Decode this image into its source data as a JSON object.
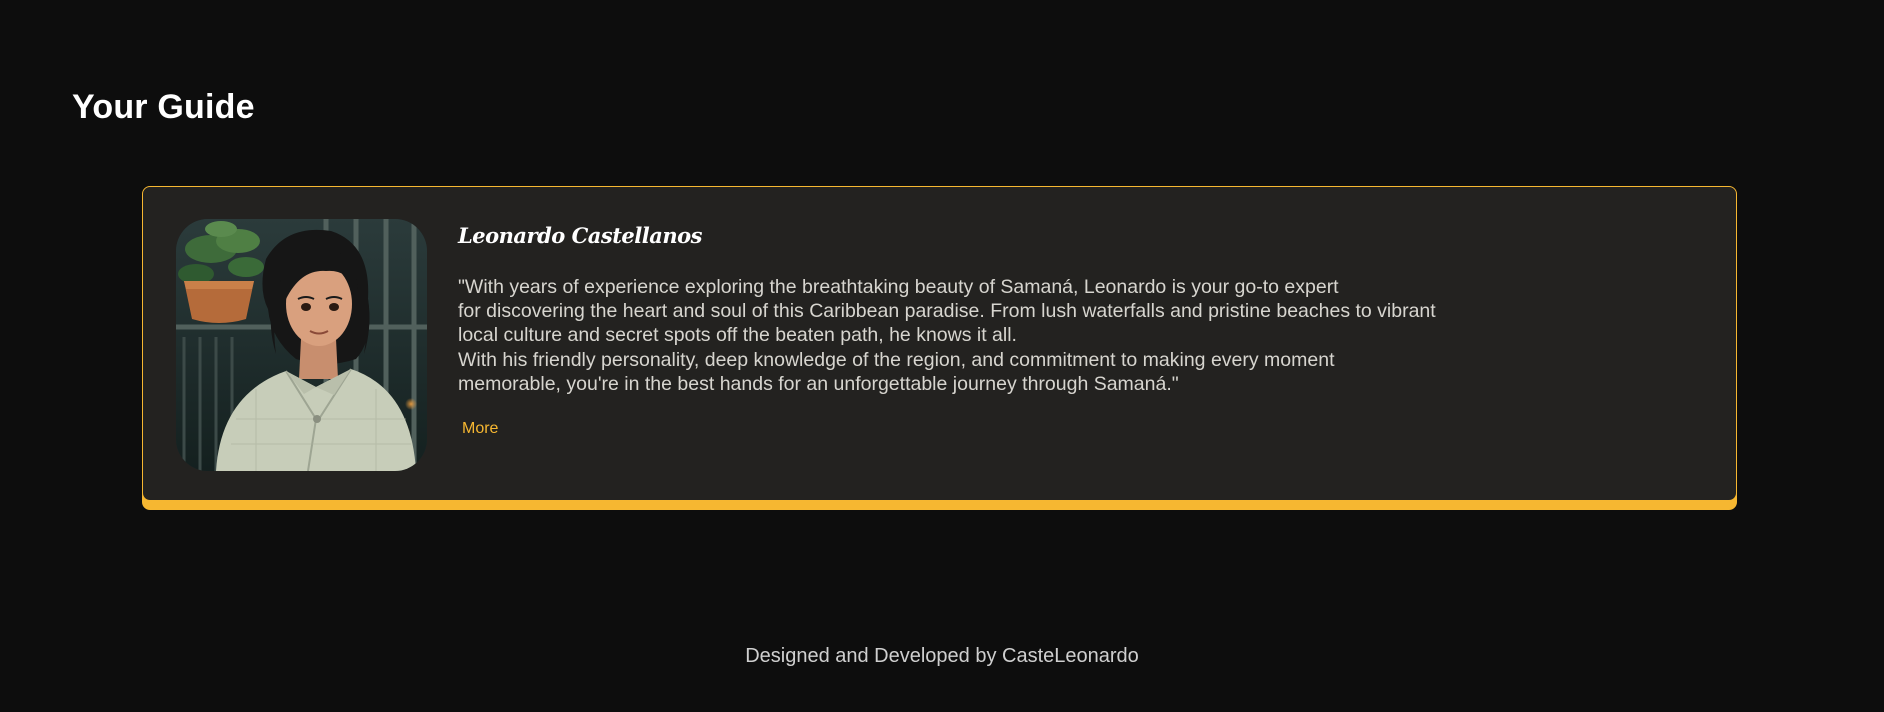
{
  "section": {
    "title": "Your Guide"
  },
  "guide": {
    "name": "Leonardo Castellanos",
    "bio_lines": [
      "\"With years of experience exploring the breathtaking beauty of Samaná, Leonardo is your go-to expert",
      "for discovering the heart and soul of this Caribbean paradise. From lush waterfalls and pristine beaches to vibrant",
      "local culture and secret spots off the beaten path, he knows it all.",
      "With his friendly personality, deep knowledge of the region, and commitment to making every moment",
      "memorable, you're in the best hands for an unforgettable journey through Samaná.\""
    ],
    "more_label": "More"
  },
  "footer": {
    "credit": "Designed and Developed by CasteLeonardo"
  },
  "colors": {
    "background": "#0d0d0d",
    "card": "#232220",
    "accent": "#f6b731",
    "text": "#d7d5cf"
  }
}
